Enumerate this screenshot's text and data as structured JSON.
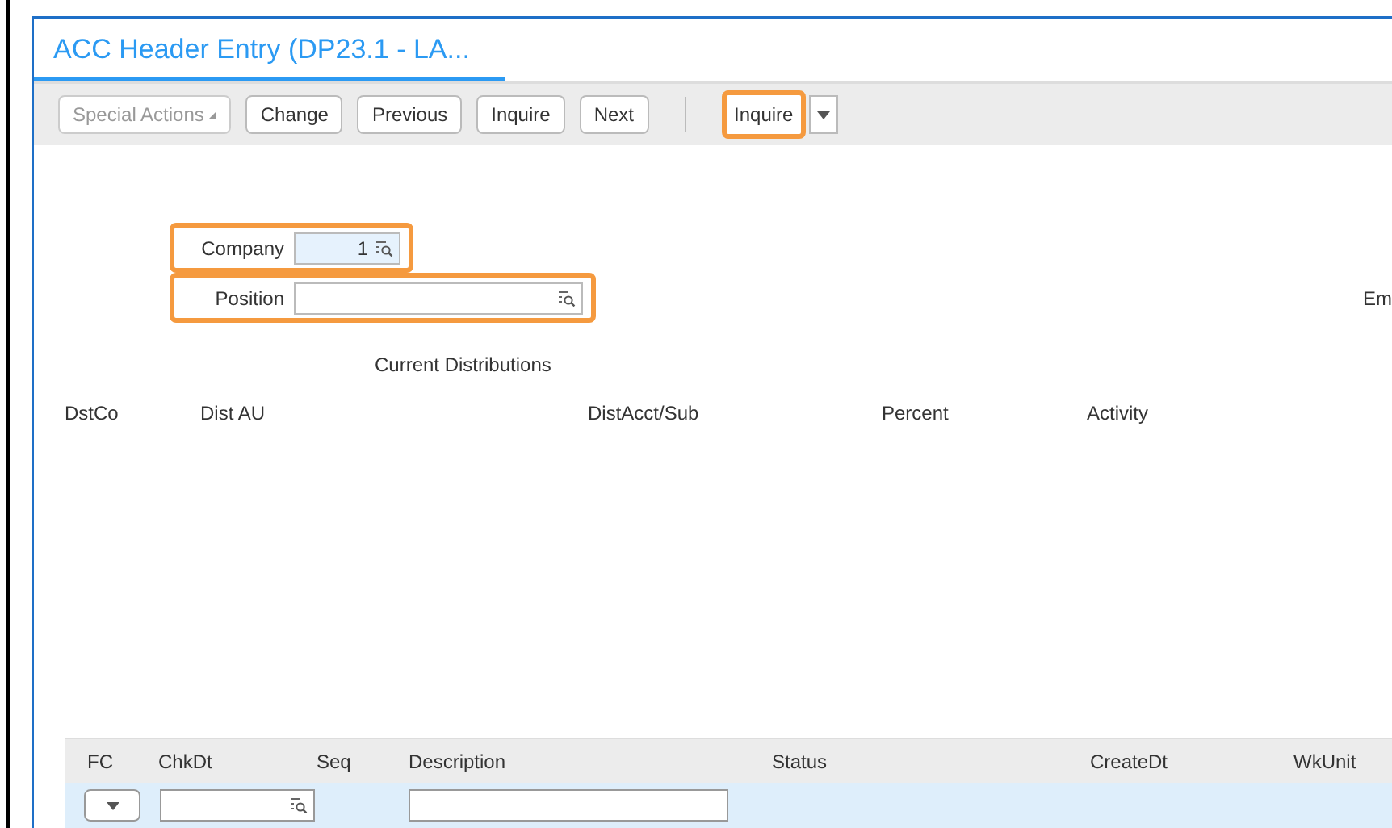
{
  "tab": {
    "title": "ACC Header Entry (DP23.1 - LA...",
    "selected": true
  },
  "toolbar": {
    "buttons": [
      {
        "label": "Special Actions",
        "kind": "menu",
        "disabled": true,
        "highlighted": false
      },
      {
        "label": "Change",
        "kind": "button",
        "disabled": false,
        "highlighted": false
      },
      {
        "label": "Previous",
        "kind": "button",
        "disabled": false,
        "highlighted": false
      },
      {
        "label": "Inquire",
        "kind": "button",
        "disabled": false,
        "highlighted": false
      },
      {
        "label": "Next",
        "kind": "button",
        "disabled": false,
        "highlighted": false
      }
    ],
    "split_button": {
      "label": "Inquire",
      "highlighted": true
    }
  },
  "fields": [
    {
      "label": "Company",
      "value": "1",
      "highlighted": true,
      "kind": "short"
    },
    {
      "label": "Position",
      "highlighted": true,
      "kind": "long"
    }
  ],
  "right_label": "Em",
  "distributions": {
    "title": "Current Distributions",
    "columns": [
      "DstCo",
      "Dist AU",
      "DistAcct/Sub",
      "Percent",
      "Activity"
    ]
  },
  "grid": {
    "columns": [
      "FC",
      "ChkDt",
      "Seq",
      "Description",
      "Status",
      "CreateDt",
      "WkUnit"
    ]
  }
}
